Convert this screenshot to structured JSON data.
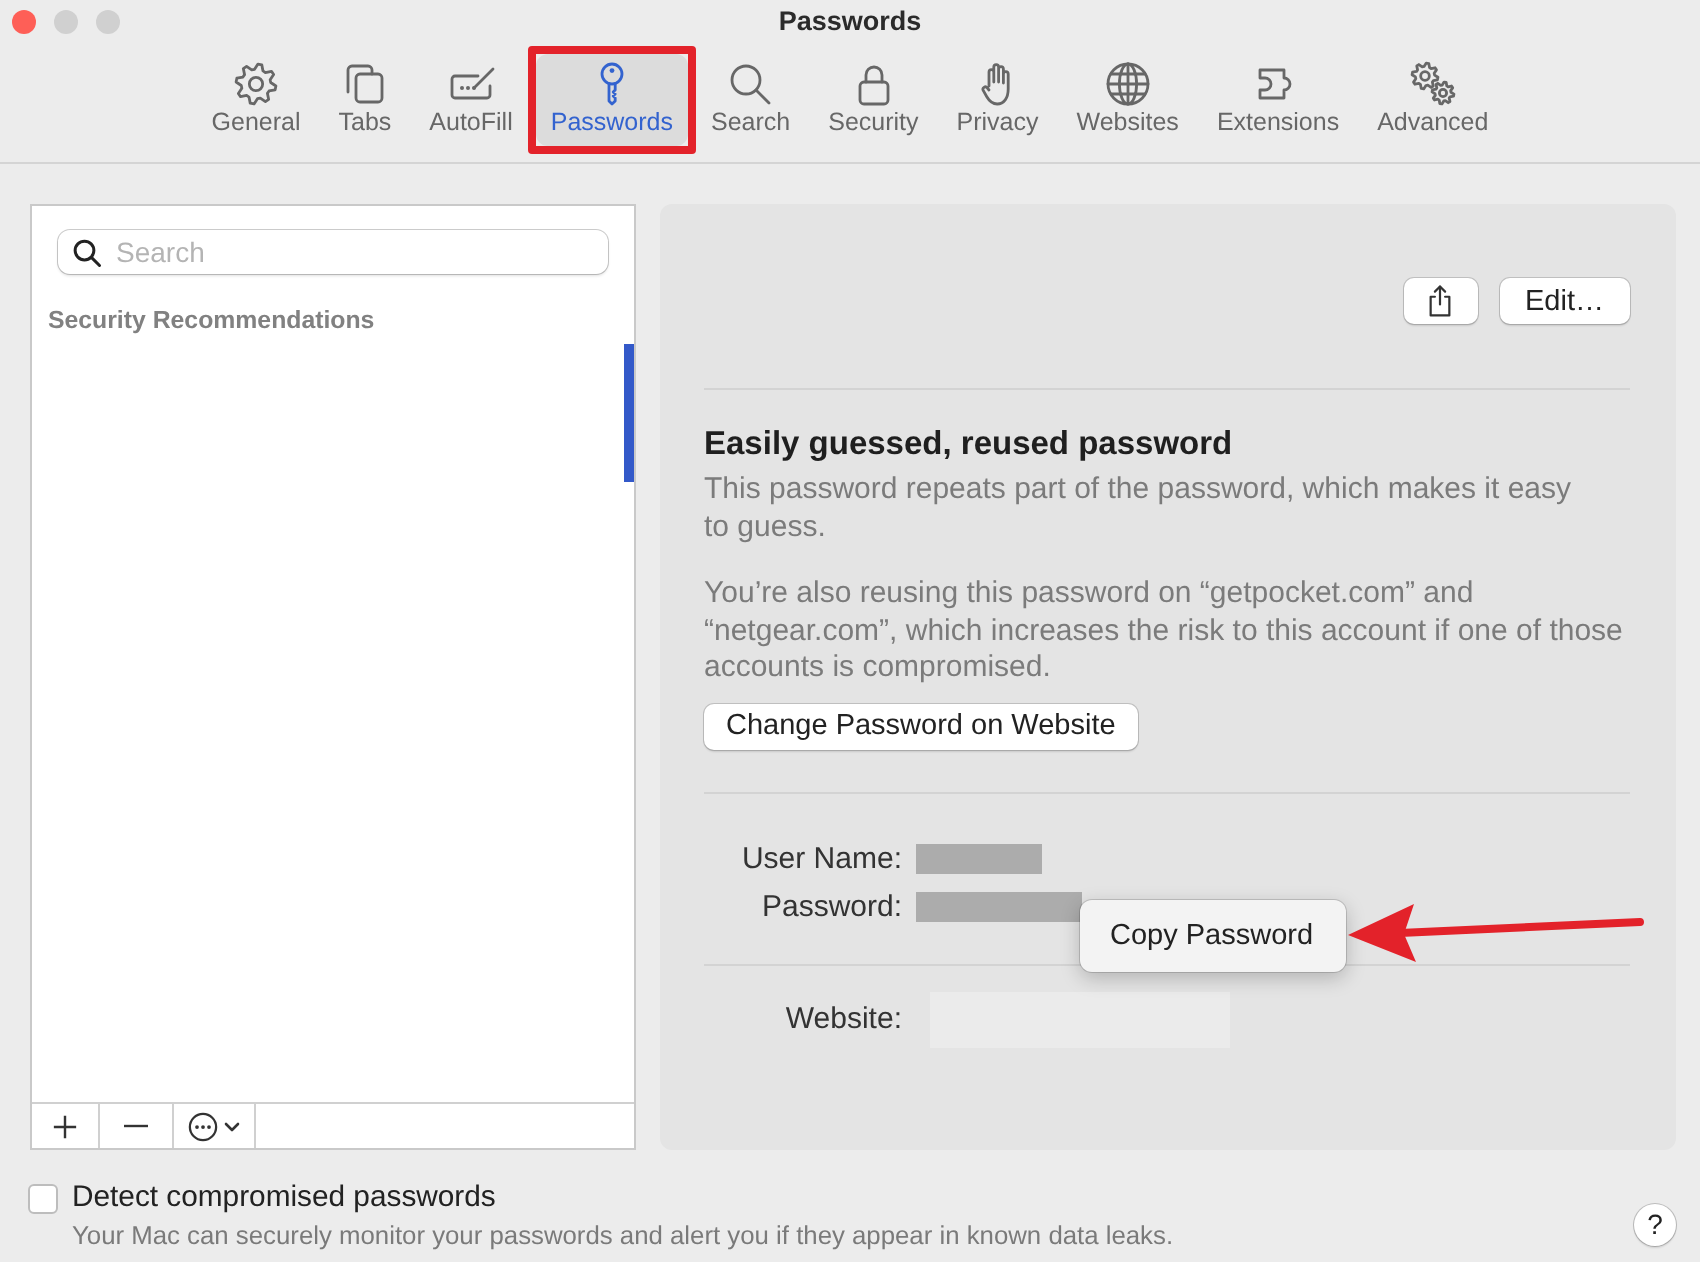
{
  "window": {
    "title": "Passwords",
    "buttons": [
      {
        "kind": "close",
        "disabled": false
      },
      {
        "kind": "minimize",
        "disabled": true
      },
      {
        "kind": "zoom",
        "disabled": true
      }
    ]
  },
  "toolbar": {
    "items": [
      {
        "kind": "general",
        "label": "General",
        "selected": false,
        "highlighted": false
      },
      {
        "kind": "tabs",
        "label": "Tabs",
        "selected": false,
        "highlighted": false
      },
      {
        "kind": "autofill",
        "label": "AutoFill",
        "selected": false,
        "highlighted": false
      },
      {
        "kind": "passwords",
        "label": "Passwords",
        "selected": true,
        "highlighted": true
      },
      {
        "kind": "search",
        "label": "Search",
        "selected": false,
        "highlighted": false
      },
      {
        "kind": "security",
        "label": "Security",
        "selected": false,
        "highlighted": false
      },
      {
        "kind": "privacy",
        "label": "Privacy",
        "selected": false,
        "highlighted": false
      },
      {
        "kind": "websites",
        "label": "Websites",
        "selected": false,
        "highlighted": false
      },
      {
        "kind": "extensions",
        "label": "Extensions",
        "selected": false,
        "highlighted": false
      },
      {
        "kind": "advanced",
        "label": "Advanced",
        "selected": false,
        "highlighted": false
      }
    ]
  },
  "sidebar": {
    "search": {
      "placeholder": "Search"
    },
    "section_header": "Security Recommendations"
  },
  "detail": {
    "actions": [
      {
        "kind": "share"
      },
      {
        "kind": "text",
        "label": "Edit…"
      }
    ],
    "warning": {
      "title": "Easily guessed, reused password",
      "paragraphs": [
        "This password repeats part of the password, which makes it easy to guess.",
        "You’re also reusing this password on “getpocket.com” and “netgear.com”, which increases the risk to this account if one of those accounts is compromised."
      ]
    },
    "action_button": "Change Password on Website",
    "credentials": [
      {
        "label": "User Name:",
        "redacted": true
      },
      {
        "label": "Password:",
        "redacted": true
      }
    ],
    "website": {
      "label": "Website:",
      "redacted": true
    }
  },
  "context_menu": {
    "items": [
      {
        "label": "Copy Password"
      }
    ],
    "arrow": true
  },
  "footer": {
    "detect": {
      "label": "Detect compromised passwords",
      "checked": false,
      "description": "Your Mac can securely monitor your passwords and alert you if they appear in known data leaks."
    },
    "help": "?"
  }
}
